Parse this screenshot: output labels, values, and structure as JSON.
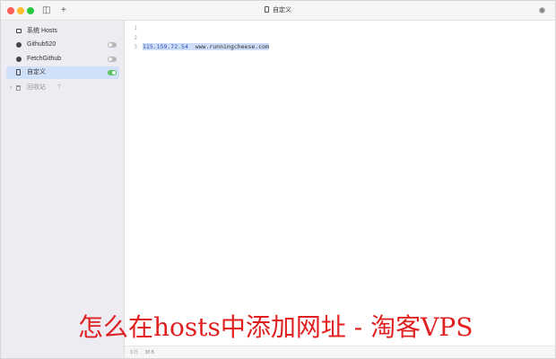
{
  "window": {
    "title": "自定义"
  },
  "sidebar": {
    "items": [
      {
        "label": "系统 Hosts",
        "icon": "monitor-icon"
      },
      {
        "label": "Github520",
        "icon": "remote-icon",
        "toggle": "off"
      },
      {
        "label": "FetchGithub",
        "icon": "remote-icon",
        "toggle": "off"
      },
      {
        "label": "自定义",
        "icon": "document-icon",
        "toggle": "on",
        "active": true
      }
    ],
    "trash": {
      "label": "回收站",
      "help": "?"
    }
  },
  "editor": {
    "line_numbers": [
      "1",
      "2",
      "3"
    ],
    "lines": [
      {
        "ip": "",
        "host": ""
      },
      {
        "ip": "",
        "host": ""
      },
      {
        "ip": "115.159.72.54",
        "host": "www.runningcheese.com"
      }
    ]
  },
  "statusbar": {
    "lines": "3 行",
    "bytes": "38 B"
  },
  "watermark": {
    "text": "怎么在hosts中添加网址 - 淘客VPS"
  },
  "colors": {
    "active_item": "#cfe0f8",
    "toggle_on": "#5dc262",
    "watermark": "#e02020",
    "ip": "#2c4fbf"
  }
}
